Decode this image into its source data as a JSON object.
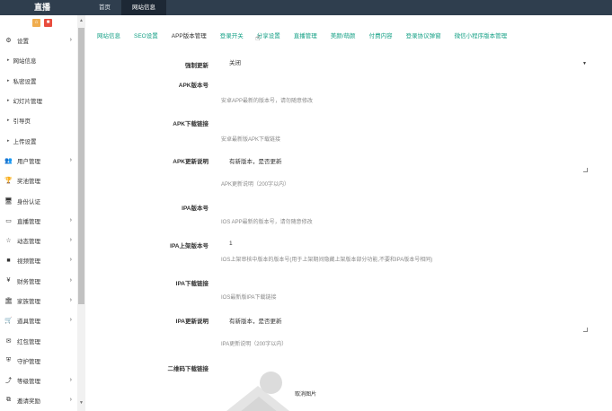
{
  "header": {
    "logo": "直播",
    "nav": [
      {
        "label": "首页",
        "active": false
      },
      {
        "label": "网站信息",
        "active": true
      }
    ]
  },
  "sidebar": {
    "tools": [
      "⌂",
      "■"
    ],
    "items": [
      {
        "label": "设置",
        "icon": "gears-icon",
        "glyph": "⚙",
        "arrow": true,
        "sub": false
      },
      {
        "label": "网站信息",
        "sub": true
      },
      {
        "label": "私密设置",
        "sub": true
      },
      {
        "label": "幻灯片管理",
        "sub": true
      },
      {
        "label": "引导页",
        "sub": true
      },
      {
        "label": "上传设置",
        "sub": true
      },
      {
        "label": "用户管理",
        "icon": "users-icon",
        "glyph": "👥",
        "arrow": true,
        "sub": false
      },
      {
        "label": "奖池管理",
        "icon": "trophy-icon",
        "glyph": "🏆",
        "arrow": false,
        "sub": false
      },
      {
        "label": "身份认证",
        "icon": "desktop-icon",
        "glyph": "🖥",
        "arrow": false,
        "sub": false
      },
      {
        "label": "直播管理",
        "icon": "monitor-icon",
        "glyph": "▭",
        "arrow": true,
        "sub": false
      },
      {
        "label": "动态管理",
        "icon": "star-icon",
        "glyph": "☆",
        "arrow": true,
        "sub": false
      },
      {
        "label": "视频管理",
        "icon": "video-icon",
        "glyph": "■",
        "arrow": true,
        "sub": false
      },
      {
        "label": "财务管理",
        "icon": "yen-icon",
        "glyph": "¥",
        "arrow": true,
        "sub": false
      },
      {
        "label": "家族管理",
        "icon": "bank-icon",
        "glyph": "🏛",
        "arrow": true,
        "sub": false
      },
      {
        "label": "道具管理",
        "icon": "cart-icon",
        "glyph": "🛒",
        "arrow": true,
        "sub": false
      },
      {
        "label": "红包管理",
        "icon": "envelope-icon",
        "glyph": "✉",
        "arrow": false,
        "sub": false
      },
      {
        "label": "守护管理",
        "icon": "shield-icon",
        "glyph": "⛨",
        "arrow": false,
        "sub": false
      },
      {
        "label": "等级管理",
        "icon": "level-icon",
        "glyph": "⤴",
        "arrow": true,
        "sub": false
      },
      {
        "label": "邀请奖励",
        "icon": "sitemap-icon",
        "glyph": "⧉",
        "arrow": true,
        "sub": false
      }
    ]
  },
  "tabs": [
    {
      "label": "网站信息",
      "active": false
    },
    {
      "label": "SEO设置",
      "active": false
    },
    {
      "label": "APP版本管理",
      "active": true
    },
    {
      "label": "登录开关",
      "active": false
    },
    {
      "label": "分享设置",
      "active": false
    },
    {
      "label": "直播管理",
      "active": false
    },
    {
      "label": "美颜/萌颜",
      "active": false
    },
    {
      "label": "付费内容",
      "active": false
    },
    {
      "label": "登录协议弹窗",
      "active": false
    },
    {
      "label": "微信小程序版本管理",
      "active": false
    }
  ],
  "form": {
    "force_update": {
      "label": "强制更新",
      "value": "关闭"
    },
    "apk_version": {
      "label": "APK版本号",
      "hint": "安卓APP最新的版本号，请勿随意修改"
    },
    "apk_link": {
      "label": "APK下载链接",
      "hint": "安卓最新版APK下载链接"
    },
    "apk_desc": {
      "label": "APK更新说明",
      "value": "有新版本，是否更新",
      "hint": "APK更新说明（200字以内）"
    },
    "ipa_version": {
      "label": "IPA版本号",
      "hint": "IOS APP最新的版本号，请勿随意修改"
    },
    "ipa_shelf_version": {
      "label": "IPA上架版本号",
      "value": "1",
      "hint": "IOS上架审核中版本的版本号(用于上架期间隐藏上架版本部分功能,不要和IPA版本号相同)"
    },
    "ipa_link": {
      "label": "IPA下载链接",
      "hint": "IOS最新版IPA下载链接"
    },
    "ipa_desc": {
      "label": "IPA更新说明",
      "value": "有新版本，是否更新",
      "hint": "IPA更新说明（200字以内）"
    },
    "qrcode": {
      "label": "二维码下载链接",
      "cancel": "取消图片"
    }
  }
}
